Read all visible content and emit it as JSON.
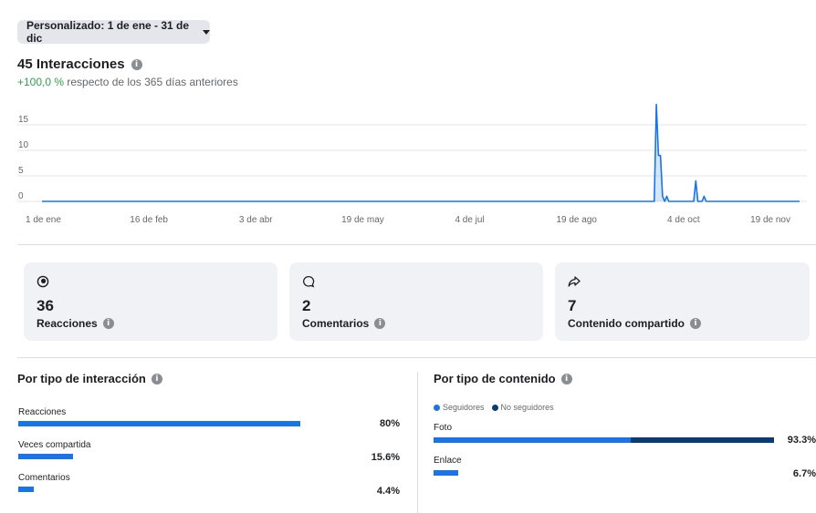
{
  "date_range": {
    "label": "Personalizado: 1 de ene - 31 de dic"
  },
  "summary": {
    "title": "45 Interacciones",
    "change": "+100,0 %",
    "change_text": "respecto de los 365 días anteriores"
  },
  "chart_data": {
    "type": "area",
    "title": "",
    "xlabel": "",
    "ylabel": "",
    "x_tick_labels": [
      "1 de ene",
      "16 de feb",
      "3 de abr",
      "19 de may",
      "4 de jul",
      "19 de ago",
      "4 de oct",
      "19 de nov"
    ],
    "y_tick_labels": [
      "0",
      "5",
      "10",
      "15"
    ],
    "ylim": [
      0,
      19
    ],
    "grid": true,
    "color": "#1b74e4",
    "series": [
      {
        "x": [
          "2024-01-01",
          "2024-10-22",
          "2024-10-23",
          "2024-10-24",
          "2024-10-25",
          "2024-10-26",
          "2024-10-27",
          "2024-10-28",
          "2024-10-29",
          "2024-10-30",
          "2024-10-31",
          "2024-11-01",
          "2024-11-10",
          "2024-11-11",
          "2024-11-12",
          "2024-11-13",
          "2024-11-14",
          "2024-11-15",
          "2024-11-16",
          "2024-11-17",
          "2024-12-31"
        ],
        "y": [
          0,
          0,
          19,
          9,
          9,
          1,
          0,
          1,
          0,
          0,
          0,
          0,
          0,
          4,
          0,
          0,
          0,
          1,
          0,
          0,
          0
        ]
      }
    ]
  },
  "cards": [
    {
      "icon": "reactions-icon",
      "value": "36",
      "label": "Reacciones"
    },
    {
      "icon": "comment-icon",
      "value": "2",
      "label": "Comentarios"
    },
    {
      "icon": "share-icon",
      "value": "7",
      "label": "Contenido compartido"
    }
  ],
  "by_interaction": {
    "title": "Por tipo de interacción",
    "rows": [
      {
        "label": "Reacciones",
        "percent": 80,
        "display": "80%"
      },
      {
        "label": "Veces compartida",
        "percent": 15.6,
        "display": "15.6%"
      },
      {
        "label": "Comentarios",
        "percent": 4.4,
        "display": "4.4%"
      }
    ]
  },
  "by_content": {
    "title": "Por tipo de contenido",
    "legend": [
      {
        "label": "Seguidores",
        "color": "#1b74e4"
      },
      {
        "label": "No seguidores",
        "color": "#0b3b76"
      }
    ],
    "rows": [
      {
        "label": "Foto",
        "percent": 93.3,
        "followers_share": 0.58,
        "display": "93.3%"
      },
      {
        "label": "Enlace",
        "percent": 6.7,
        "followers_share": 1.0,
        "display": "6.7%"
      }
    ]
  },
  "colors": {
    "accent": "#1b74e4",
    "dark_accent": "#0b3b76",
    "positive": "#31a24c"
  }
}
